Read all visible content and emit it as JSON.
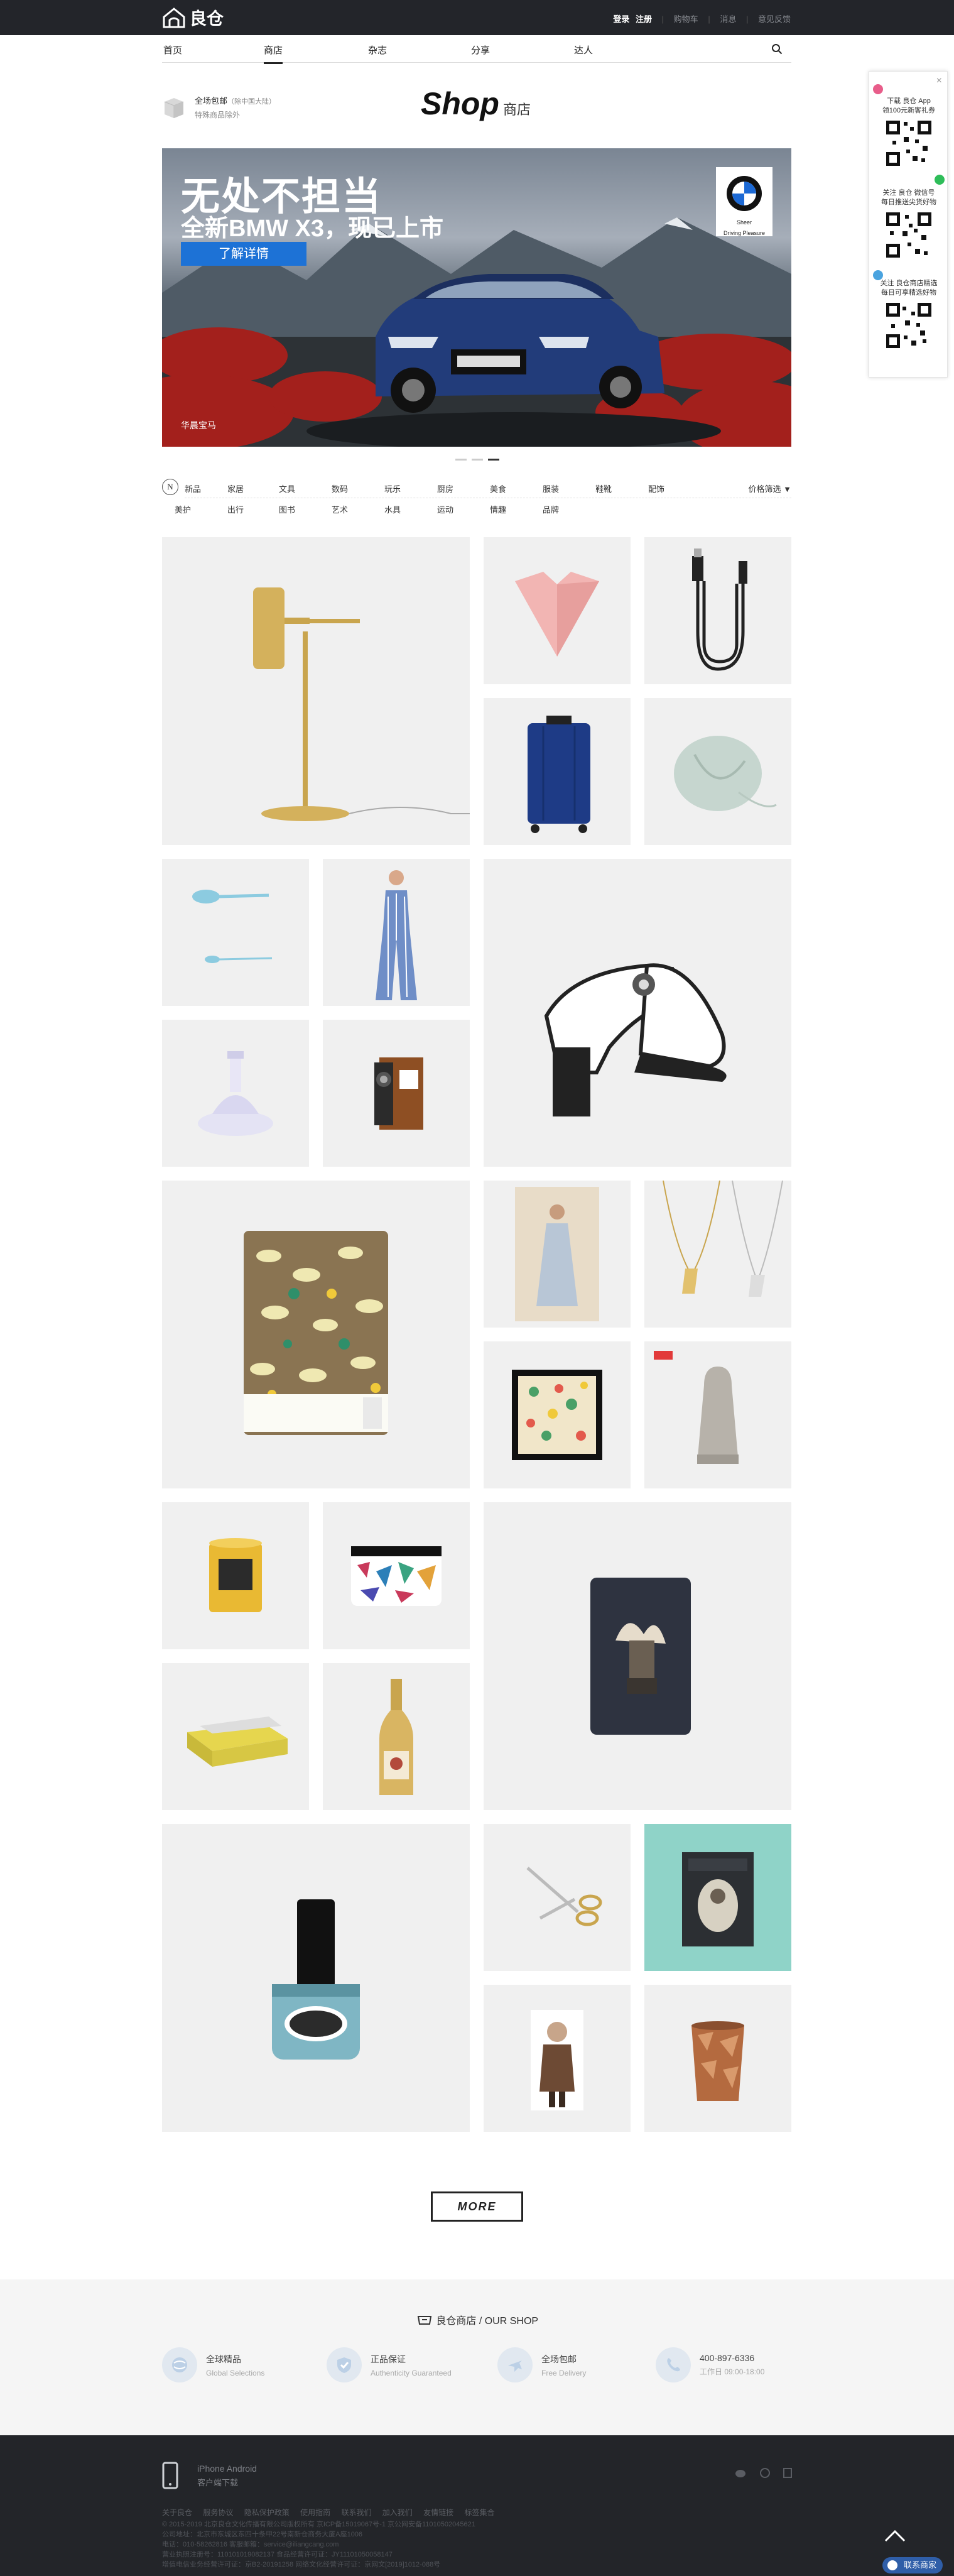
{
  "topbar": {
    "brand": "良仓",
    "login": "登录",
    "register": "注册",
    "cart": "购物车",
    "notifications": "消息",
    "feedback": "意见反馈"
  },
  "nav": {
    "items": [
      "首页",
      "商店",
      "杂志",
      "分享",
      "达人"
    ],
    "active": "商店"
  },
  "shipping": {
    "line1": "全场包邮",
    "line1_note": "（除中国大陆）",
    "line2": "特殊商品除外"
  },
  "shop_title": {
    "en": "Shop",
    "cn": "商店"
  },
  "banner": {
    "headline": "无处不担当",
    "subline": "全新BMW X3，现已上市",
    "button": "了解详情",
    "brand_tagline_1": "Sheer",
    "brand_tagline_2": "Driving Pleasure",
    "caption": "华晨宝马",
    "plate": "全新BMW X3"
  },
  "filter": {
    "badge": "N",
    "row1": [
      "新品",
      "家居",
      "文具",
      "数码",
      "玩乐",
      "厨房",
      "美食",
      "服装",
      "鞋靴",
      "配饰"
    ],
    "row2": [
      "美护",
      "出行",
      "图书",
      "艺术",
      "水具",
      "运动",
      "情趣",
      "品牌"
    ],
    "sort_label": "价格筛选"
  },
  "products": [
    "brass-desk-lamp",
    "pink-heart-dish",
    "usb-cable",
    "blue-suitcase",
    "mint-earbud-case",
    "blue-spoon",
    "striped-jumpsuit",
    "white-mule-heel",
    "glass-diffuser",
    "instant-camera",
    "floral-notebook",
    "white-dress",
    "gold-necklace",
    "floral-art-print",
    "stone-diffuser",
    "yellow-candle",
    "printed-pouch",
    "shaving-brush",
    "yellow-towels",
    "champagne-bottle",
    "nail-polish",
    "gold-scissors",
    "english-book",
    "figure-pillow",
    "copper-cup"
  ],
  "more_button": "MORE",
  "promo": {
    "title": "良仓商店 / OUR SHOP",
    "features": [
      {
        "cn": "全球精品",
        "en": "Global Selections"
      },
      {
        "cn": "正品保证",
        "en": "Authenticity Guaranteed"
      },
      {
        "cn": "全场包邮",
        "en": "Free Delivery"
      },
      {
        "cn": "400-897-6336",
        "en": "工作日 09:00-18:00"
      }
    ]
  },
  "footer": {
    "app_line1": "iPhone Android",
    "app_line2": "客户端下载",
    "links": [
      "关于良仓",
      "服务协议",
      "隐私保护政策",
      "使用指南",
      "联系我们",
      "加入我们",
      "友情链接",
      "标签集合"
    ],
    "copy_1": "© 2015-2019 北京良仓文化传播有限公司版权所有 京ICP备15019067号-1 京公网安备11010502045621",
    "copy_2": "公司地址：北京市东城区东四十条甲22号南新仓商务大厦A座1006",
    "copy_3": "电话：010-58262816  客服邮箱：service@iliangcang.com",
    "copy_4": "营业执照注册号：110101019082137  食品经营许可证：JY11101050058147",
    "copy_5": "增值电信业务经营许可证：京B2-20191258  网络文化经营许可证：京网文[2019]1012-088号"
  },
  "chat_button": "联系商家",
  "side_panel": {
    "app_1": "下载 良仓 App",
    "app_2": "领100元新客礼券",
    "wechat_1": "关注 良仓 微信号",
    "wechat_2": "每日推送尖货好物",
    "mini_1": "关注 良仓商店精选",
    "mini_2": "每日可享精选好物"
  },
  "colors": {
    "topbar": "#23252a",
    "footer": "#232529",
    "accent": "#1d72d6",
    "panel_pink": "#e85d8a",
    "panel_green": "#2ebd59",
    "panel_blue": "#4aa3df"
  }
}
